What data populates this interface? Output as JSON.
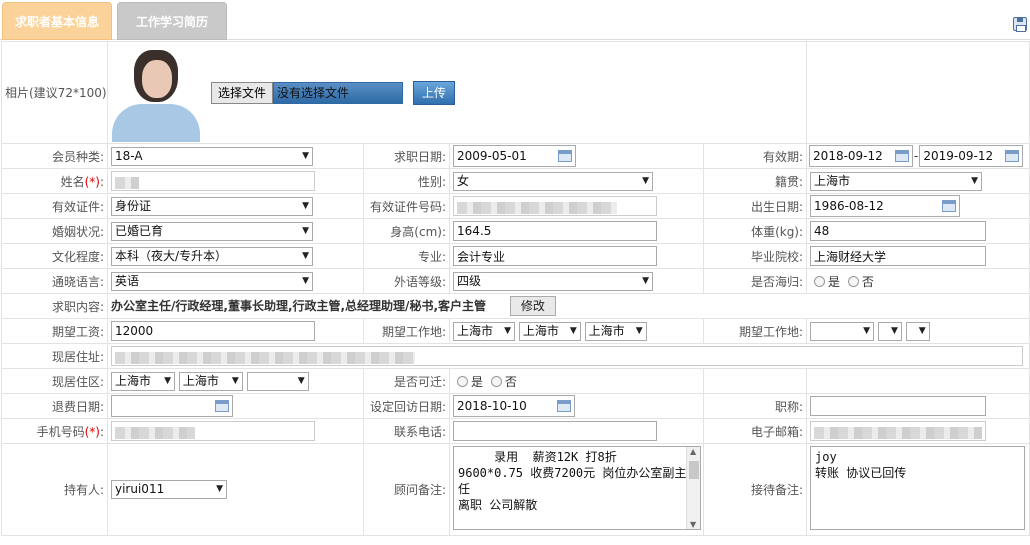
{
  "tabs": [
    {
      "label": "求职者基本信息"
    },
    {
      "label": "工作学习简历"
    }
  ],
  "photo": {
    "label": "相片(建议72*100):",
    "choose_file": "选择文件",
    "no_file": "没有选择文件",
    "upload": "上传"
  },
  "rows": {
    "member_type": {
      "label": "会员种类:",
      "value": "18-A"
    },
    "apply_date": {
      "label": "求职日期:",
      "value": "2009-05-01"
    },
    "valid_period": {
      "label": "有效期:",
      "from": "2018-09-12",
      "sep": "-",
      "to": "2019-09-12"
    },
    "name": {
      "label": "姓名",
      "req": "(*)",
      "colon": ":"
    },
    "gender": {
      "label": "性别:",
      "value": "女"
    },
    "native": {
      "label": "籍贯:",
      "value": "上海市"
    },
    "id_type": {
      "label": "有效证件:",
      "value": "身份证"
    },
    "id_no": {
      "label": "有效证件号码:"
    },
    "birth": {
      "label": "出生日期:",
      "value": "1986-08-12"
    },
    "marital": {
      "label": "婚姻状况:",
      "value": "已婚已育"
    },
    "height": {
      "label": "身高(cm):",
      "value": "164.5"
    },
    "weight": {
      "label": "体重(kg):",
      "value": "48"
    },
    "education": {
      "label": "文化程度:",
      "value": "本科（夜大/专升本）"
    },
    "major": {
      "label": "专业:",
      "value": "会计专业"
    },
    "school": {
      "label": "毕业院校:",
      "value": "上海财经大学"
    },
    "language": {
      "label": "通晓语言:",
      "value": "英语"
    },
    "lang_level": {
      "label": "外语等级:",
      "value": "四级"
    },
    "overseas": {
      "label": "是否海归:",
      "yes": "是",
      "no": "否"
    },
    "job_content": {
      "label": "求职内容:",
      "value": "办公室主任/行政经理,董事长助理,行政主管,总经理助理/秘书,客户主管",
      "modify": "修改"
    },
    "salary": {
      "label": "期望工资:",
      "value": "12000"
    },
    "work_place": {
      "label": "期望工作地:",
      "v1": "上海市",
      "v2": "上海市",
      "v3": "上海市"
    },
    "work_place2": {
      "label": "期望工作地:"
    },
    "address": {
      "label": "现居住址:"
    },
    "district": {
      "label": "现居住区:",
      "v1": "上海市",
      "v2": "上海市"
    },
    "relocate": {
      "label": "是否可迁:",
      "yes": "是",
      "no": "否"
    },
    "refund_date": {
      "label": "退费日期:"
    },
    "visit_date": {
      "label": "设定回访日期:",
      "value": "2018-10-10"
    },
    "title": {
      "label": "职称:"
    },
    "mobile": {
      "label": "手机号码",
      "req": "(*)",
      "colon": ":"
    },
    "phone": {
      "label": "联系电话:"
    },
    "email": {
      "label": "电子邮箱:"
    },
    "holder": {
      "label": "持有人:",
      "value": "yirui011"
    },
    "advisor_note": {
      "label": "顾问备注:",
      "value": "     录用  薪资12K 打8折\n9600*0.75 收费7200元 岗位办公室副主任\n离职 公司解散"
    },
    "reception_note": {
      "label": "接待备注:",
      "value": "joy\n转账 协议已回传"
    }
  }
}
